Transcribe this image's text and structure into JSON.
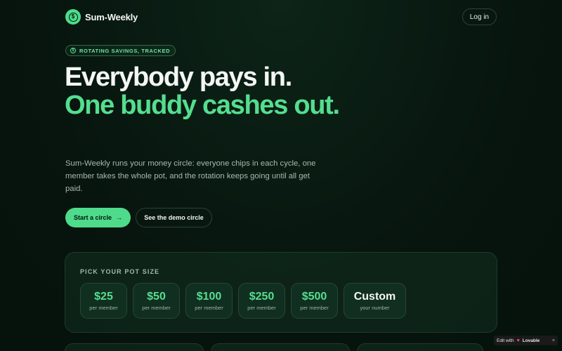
{
  "header": {
    "brand_name": "Sum-Weekly",
    "logo_glyph": "$",
    "login_label": "Log in"
  },
  "hero": {
    "badge_icon": "$",
    "badge_text": "ROTATING SAVINGS, TRACKED",
    "headline_line1": "Everybody pays in.",
    "headline_line2": "One buddy cashes out.",
    "subtext": "Sum-Weekly runs your money circle: everyone chips in each cycle, one member takes the whole pot, and the rotation keeps going until all get paid.",
    "primary_button": "Start a circle",
    "primary_button_arrow": "→",
    "secondary_button": "See the demo circle"
  },
  "pot_picker": {
    "title": "PICK YOUR POT SIZE",
    "options": [
      {
        "amount": "$25",
        "sub": "per member"
      },
      {
        "amount": "$50",
        "sub": "per member"
      },
      {
        "amount": "$100",
        "sub": "per member"
      },
      {
        "amount": "$250",
        "sub": "per member"
      },
      {
        "amount": "$500",
        "sub": "per member"
      },
      {
        "amount": "Custom",
        "sub": "your number"
      }
    ]
  },
  "lovable_badge": {
    "prefix": "Edit with",
    "brand": "Lovable",
    "heart": "♥",
    "close": "×"
  },
  "colors": {
    "accent": "#4edb8b",
    "background": "#07150e",
    "panel": "#123020"
  }
}
